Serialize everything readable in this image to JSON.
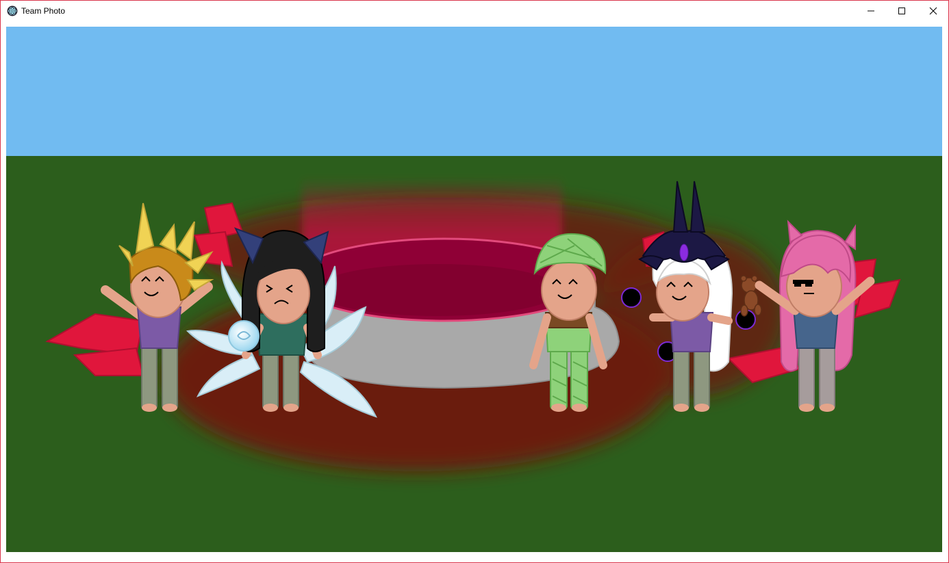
{
  "window": {
    "title": "Team Photo",
    "controls": {
      "minimize": "minimize-icon",
      "maximize": "maximize-icon",
      "close": "close-icon"
    }
  },
  "scene": {
    "sky_color": "#71bbf1",
    "grass_color": "#2c5e1c",
    "portal_color": "#a8003c",
    "ring_color": "#a8a8a8",
    "characters": [
      {
        "id": "spiked-crown-character",
        "expression": "happy",
        "hair": "gold-spiked-crown"
      },
      {
        "id": "fox-ears-character",
        "expression": "squint",
        "hair": "black-with-fox-ears"
      },
      {
        "id": "bandaged-character",
        "expression": "happy",
        "hair": "green-bandages"
      },
      {
        "id": "dark-crown-character",
        "expression": "happy",
        "hair": "white-with-dark-crown"
      },
      {
        "id": "pink-hair-character",
        "expression": "neutral-sunglasses",
        "hair": "pink-with-horns"
      }
    ]
  }
}
